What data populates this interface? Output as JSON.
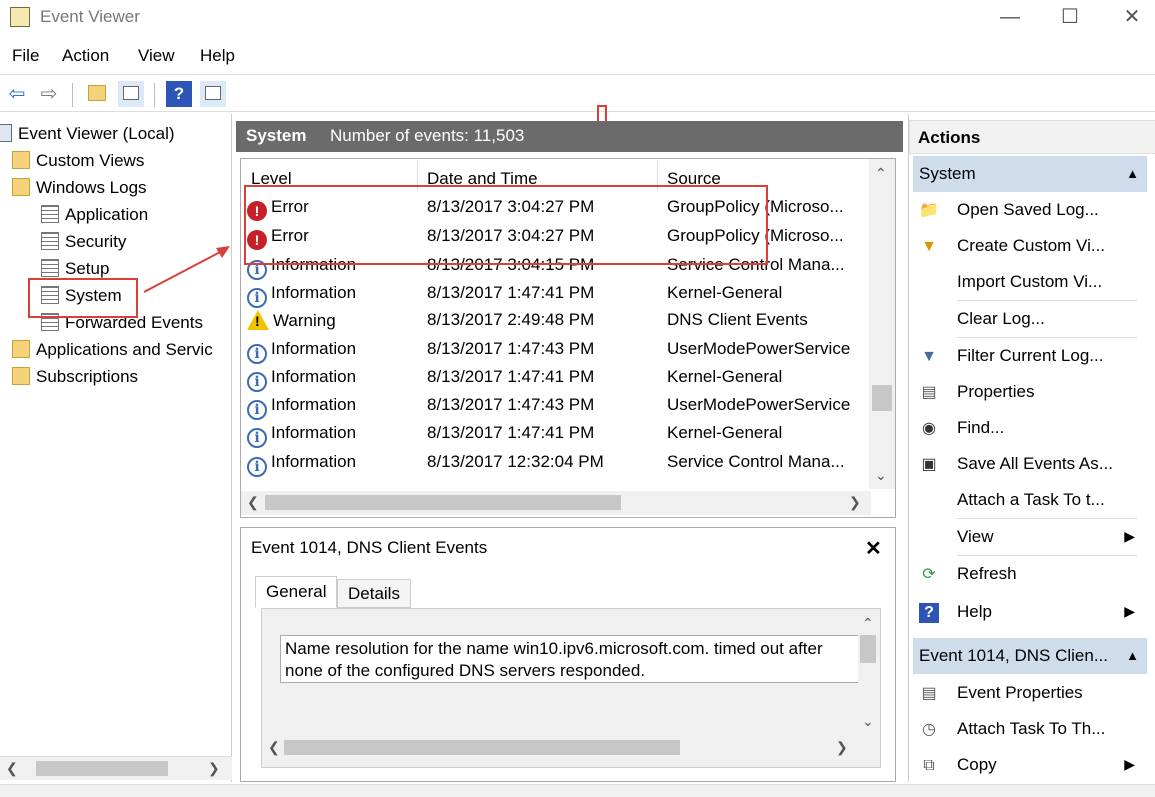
{
  "window": {
    "title": "Event Viewer",
    "minimize": "—",
    "maximize": "☐",
    "close": "✕"
  },
  "menu": [
    "File",
    "Action",
    "View",
    "Help"
  ],
  "toolbar": {
    "icons": [
      "back-icon",
      "forward-icon",
      "up-folder-icon",
      "show-hide-tree-icon",
      "help-icon",
      "show-hide-action-icon"
    ]
  },
  "tree": {
    "root": "Event Viewer (Local)",
    "custom_views": "Custom Views",
    "windows_logs": "Windows Logs",
    "logs": [
      "Application",
      "Security",
      "Setup",
      "System",
      "Forwarded Events"
    ],
    "apps_services": "Applications and Servic",
    "subscriptions": "Subscriptions"
  },
  "log_header": {
    "name": "System",
    "count_text": "Number of events: 11,503"
  },
  "grid": {
    "columns": [
      "Level",
      "Date and Time",
      "Source"
    ],
    "rows": [
      {
        "level": "Error",
        "datetime": "8/13/2017 3:04:27 PM",
        "source": "GroupPolicy (Microso..."
      },
      {
        "level": "Error",
        "datetime": "8/13/2017 3:04:27 PM",
        "source": "GroupPolicy (Microso..."
      },
      {
        "level": "Information",
        "datetime": "8/13/2017 3:04:15 PM",
        "source": "Service Control Mana..."
      },
      {
        "level": "Information",
        "datetime": "8/13/2017 1:47:41 PM",
        "source": "Kernel-General"
      },
      {
        "level": "Warning",
        "datetime": "8/13/2017 2:49:48 PM",
        "source": "DNS Client Events"
      },
      {
        "level": "Information",
        "datetime": "8/13/2017 1:47:43 PM",
        "source": "UserModePowerService"
      },
      {
        "level": "Information",
        "datetime": "8/13/2017 1:47:41 PM",
        "source": "Kernel-General"
      },
      {
        "level": "Information",
        "datetime": "8/13/2017 1:47:43 PM",
        "source": "UserModePowerService"
      },
      {
        "level": "Information",
        "datetime": "8/13/2017 1:47:41 PM",
        "source": "Kernel-General"
      },
      {
        "level": "Information",
        "datetime": "8/13/2017 12:32:04 PM",
        "source": "Service Control Mana..."
      }
    ]
  },
  "detail": {
    "title": "Event 1014, DNS Client Events",
    "close": "✕",
    "tabs": [
      "General",
      "Details"
    ],
    "description": "Name resolution for the name win10.ipv6.microsoft.com. timed out after none of the configured DNS servers responded."
  },
  "actions": {
    "title": "Actions",
    "group1": "System",
    "group1_items": [
      "Open Saved Log...",
      "Create Custom Vi...",
      "Import Custom Vi...",
      "Clear Log...",
      "Filter Current Log...",
      "Properties",
      "Find...",
      "Save All Events As...",
      "Attach a Task To t...",
      "View",
      "Refresh",
      "Help"
    ],
    "group2": "Event 1014, DNS Clien...",
    "group2_items": [
      "Event Properties",
      "Attach Task To Th...",
      "Copy"
    ]
  },
  "colors": {
    "highlight": "#d9403a",
    "header_bg": "#6b6b6b",
    "action_group_bg": "#cfdcec"
  }
}
